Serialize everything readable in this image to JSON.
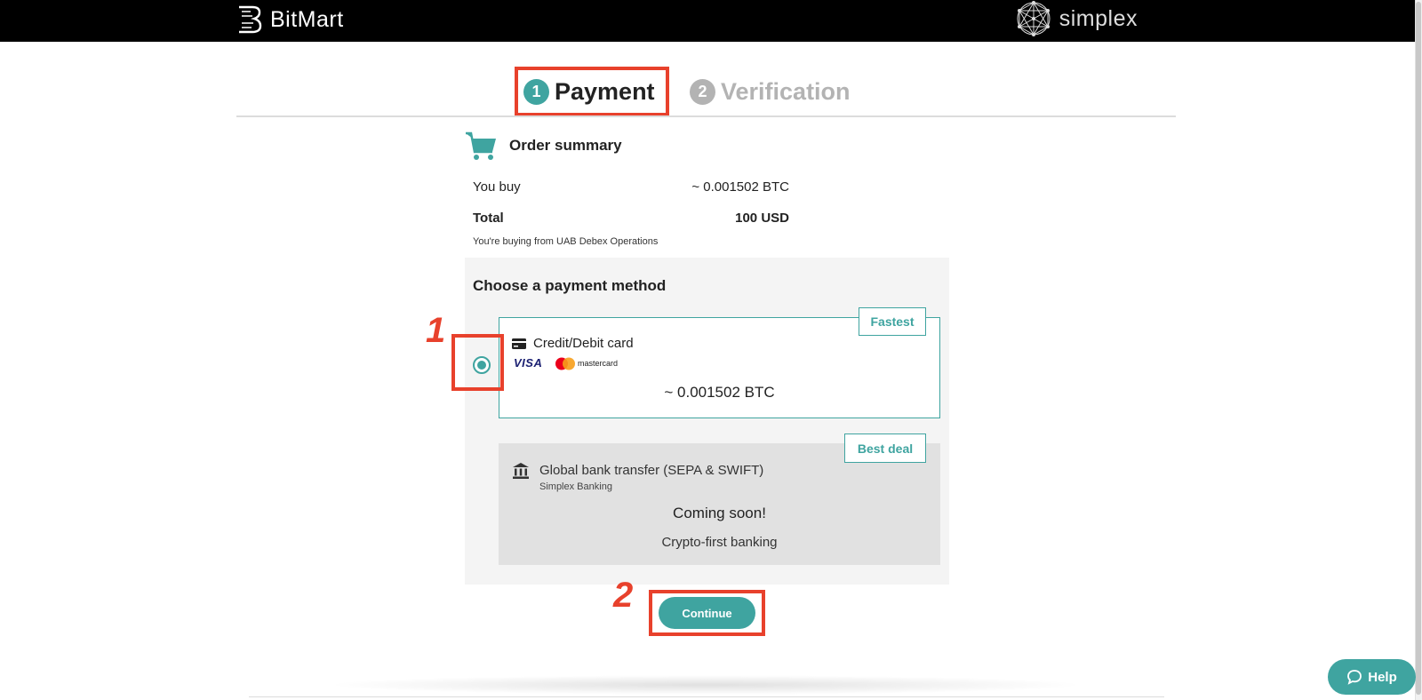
{
  "header": {
    "left_brand": "BitMart",
    "right_brand": "simplex"
  },
  "steps": [
    {
      "number": "1",
      "label": "Payment"
    },
    {
      "number": "2",
      "label": "Verification"
    }
  ],
  "order": {
    "title": "Order summary",
    "you_buy_label": "You buy",
    "you_buy_value": "~ 0.001502 BTC",
    "total_label": "Total",
    "total_value": "100 USD",
    "from_note": "You're buying from UAB Debex Operations"
  },
  "payment": {
    "title": "Choose a payment method",
    "card": {
      "tag": "Fastest",
      "label": "Credit/Debit card",
      "visa": "VISA",
      "mastercard": "mastercard",
      "btc": "~ 0.001502 BTC"
    },
    "bank": {
      "tag": "Best deal",
      "label": "Global bank transfer (SEPA & SWIFT)",
      "sublabel": "Simplex Banking",
      "coming": "Coming soon!",
      "tagline": "Crypto-first banking"
    }
  },
  "continue_label": "Continue",
  "annotations": {
    "one": "1",
    "two": "2"
  },
  "help_label": "Help",
  "colors": {
    "accent": "#3fa4a0",
    "annotation": "#e8412c",
    "header_bg": "#000000"
  }
}
